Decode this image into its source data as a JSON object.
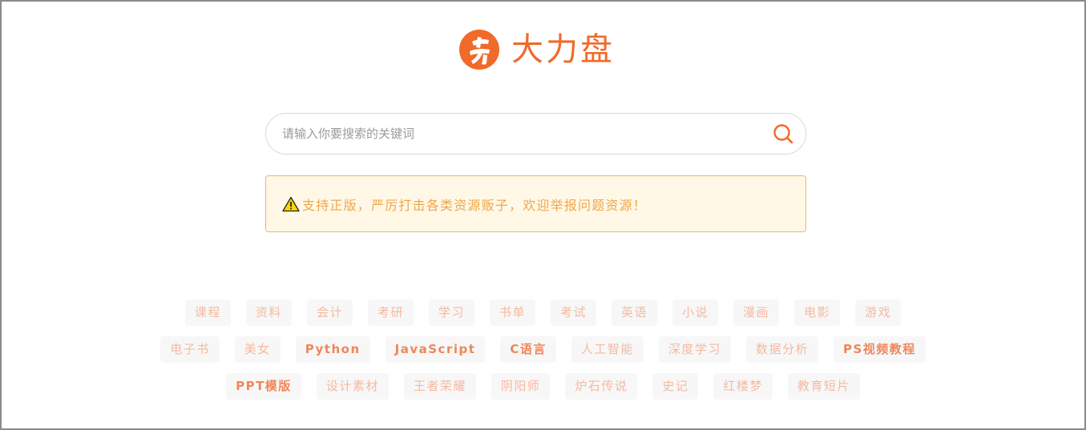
{
  "brand": {
    "name": "大力盘",
    "color": "#f06a2a"
  },
  "search": {
    "placeholder": "请输入你要搜索的关键词",
    "value": ""
  },
  "notice": {
    "text": "支持正版，严厉打击各类资源贩子，欢迎举报问题资源！",
    "icon": "warning-triangle-icon"
  },
  "tags": {
    "row1": [
      "课程",
      "资料",
      "会计",
      "考研",
      "学习",
      "书单",
      "考试",
      "英语",
      "小说",
      "漫画",
      "电影",
      "游戏"
    ],
    "row2": [
      "电子书",
      "美女",
      "Python",
      "JavaScript",
      "C语言",
      "人工智能",
      "深度学习",
      "数据分析",
      "PS视频教程"
    ],
    "row3": [
      "PPT模版",
      "设计素材",
      "王者荣耀",
      "阴阳师",
      "炉石传说",
      "史记",
      "红楼梦",
      "教育短片"
    ]
  }
}
